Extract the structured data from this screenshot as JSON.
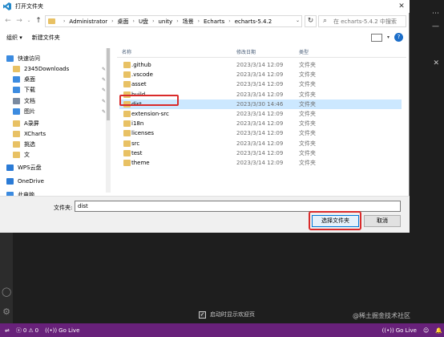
{
  "dialog": {
    "title": "打开文件夹",
    "close_glyph": "✕",
    "address": {
      "crumbs": [
        "Administrator",
        "桌面",
        "U盘",
        "unity",
        "场景",
        "Echarts",
        "echarts-5.4.2"
      ],
      "search_placeholder": "在 echarts-5.4.2 中搜索"
    },
    "toolbar": {
      "organize_label": "组织 ▾",
      "new_folder_label": "新建文件夹"
    },
    "nav": {
      "items": [
        {
          "label": "快速访问",
          "icon": "star-icon",
          "color": "#3c8be0"
        },
        {
          "label": "2345Downloads",
          "icon": "folder-icon",
          "color": "#e8c164",
          "pinned": true
        },
        {
          "label": "桌面",
          "icon": "desktop-icon",
          "color": "#3c8be0",
          "pinned": true
        },
        {
          "label": "下载",
          "icon": "download-icon",
          "color": "#3c8be0",
          "pinned": true
        },
        {
          "label": "文档",
          "icon": "document-icon",
          "color": "#7a8aa0",
          "pinned": true
        },
        {
          "label": "图片",
          "icon": "picture-icon",
          "color": "#3c8be0",
          "pinned": true
        },
        {
          "label": "A录屏",
          "icon": "folder-icon",
          "color": "#e8c164"
        },
        {
          "label": "XCharts",
          "icon": "folder-icon",
          "color": "#e8c164"
        },
        {
          "label": "挑选",
          "icon": "folder-icon",
          "color": "#e8c164"
        },
        {
          "label": "文",
          "icon": "folder-icon",
          "color": "#e8c164"
        },
        {
          "label": "WPS云盘",
          "icon": "cloud-icon",
          "color": "#2b7bd6"
        },
        {
          "label": "OneDrive",
          "icon": "cloud-icon",
          "color": "#2b7bd6"
        },
        {
          "label": "此电脑",
          "icon": "computer-icon",
          "color": "#3c8be0"
        }
      ],
      "pin_glyph": "✎"
    },
    "files": {
      "headers": {
        "name": "名称",
        "date": "修改日期",
        "type": "类型"
      },
      "rows": [
        {
          "name": ".github",
          "date": "2023/3/14 12:09",
          "type": "文件夹"
        },
        {
          "name": ".vscode",
          "date": "2023/3/14 12:09",
          "type": "文件夹"
        },
        {
          "name": "asset",
          "date": "2023/3/14 12:09",
          "type": "文件夹"
        },
        {
          "name": "build",
          "date": "2023/3/14 12:09",
          "type": "文件夹"
        },
        {
          "name": "dist",
          "date": "2023/3/30 14:46",
          "type": "文件夹",
          "selected": true
        },
        {
          "name": "extension-src",
          "date": "2023/3/14 12:09",
          "type": "文件夹"
        },
        {
          "name": "i18n",
          "date": "2023/3/14 12:09",
          "type": "文件夹"
        },
        {
          "name": "licenses",
          "date": "2023/3/14 12:09",
          "type": "文件夹"
        },
        {
          "name": "src",
          "date": "2023/3/14 12:09",
          "type": "文件夹"
        },
        {
          "name": "test",
          "date": "2023/3/14 12:09",
          "type": "文件夹"
        },
        {
          "name": "theme",
          "date": "2023/3/14 12:09",
          "type": "文件夹"
        }
      ]
    },
    "bottom": {
      "folder_label": "文件夹:",
      "folder_value": "dist",
      "select_button": "选择文件夹",
      "cancel_button": "取消"
    }
  },
  "vscode": {
    "welcome_label": "启动时显示欢迎页",
    "status": {
      "errors": "0",
      "warnings": "0",
      "live_left": "Go Live",
      "live_right": "Go Live"
    },
    "watermark": "@稀土掘金技术社区"
  },
  "colors": {
    "accent": "#0078d7",
    "highlight": "#d92b2b",
    "status_bar": "#68217a",
    "selection": "#cce8ff"
  }
}
